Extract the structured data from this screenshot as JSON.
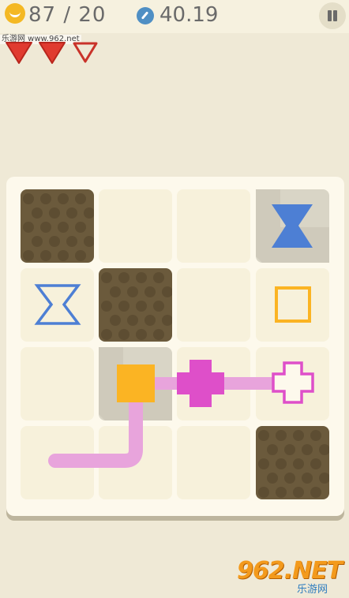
{
  "hud": {
    "score": "87 / 20",
    "timer": "40.19",
    "icons": {
      "coins": "coin-icon",
      "timer": "pencil-timer-icon",
      "pause": "pause-icon"
    }
  },
  "lives": {
    "total": 3,
    "filled": 2,
    "color": "#e03b30"
  },
  "watermarks": {
    "top": "乐游网 www.962.net",
    "logo": "962.NET",
    "sub": "乐游网"
  },
  "board": {
    "rows": 4,
    "cols": 4,
    "blocked": [
      [
        0,
        0
      ],
      [
        1,
        1
      ],
      [
        3,
        3
      ]
    ],
    "colors": {
      "block": "#6b5a3c",
      "blue": "#4d7fd4",
      "orange": "#fbb423",
      "magenta": "#de4fc9",
      "path": "#e8a4dc"
    },
    "pieces": [
      {
        "name": "hourglass-filled-piece",
        "shape": "hourglass",
        "style": "filled",
        "row": 0,
        "col": 3
      },
      {
        "name": "hourglass-target",
        "shape": "hourglass",
        "style": "outline",
        "row": 1,
        "col": 0
      },
      {
        "name": "square-target",
        "shape": "square",
        "style": "outline",
        "row": 1,
        "col": 3
      },
      {
        "name": "square-filled-piece",
        "shape": "square",
        "style": "filled",
        "row": 2,
        "col": 1
      },
      {
        "name": "cross-filled-piece",
        "shape": "cross",
        "style": "filled",
        "row": 2,
        "col": 2
      },
      {
        "name": "cross-target",
        "shape": "cross",
        "style": "outline",
        "row": 2,
        "col": 3
      }
    ]
  }
}
